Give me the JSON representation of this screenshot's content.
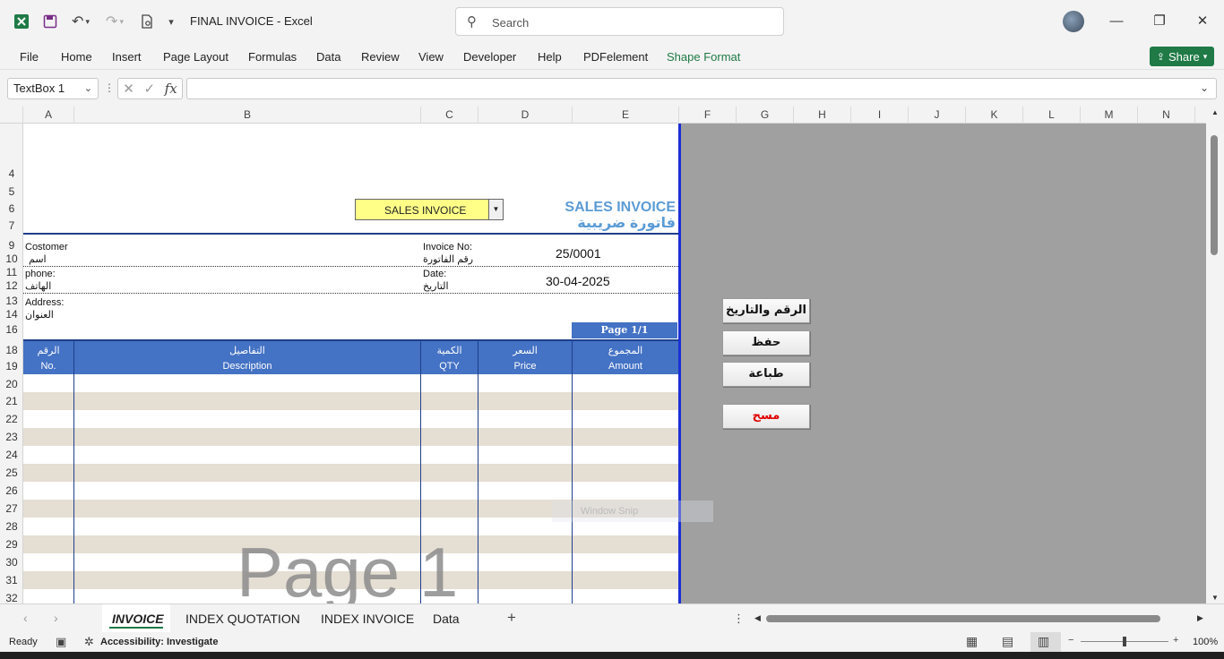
{
  "titlebar": {
    "doc_title": "FINAL INVOICE  -  Excel",
    "search_placeholder": "Search"
  },
  "menu": [
    "File",
    "Home",
    "Insert",
    "Page Layout",
    "Formulas",
    "Data",
    "Review",
    "View",
    "Developer",
    "Help",
    "PDFelement",
    "Shape Format"
  ],
  "share_label": "Share",
  "namebox": "TextBox 1",
  "fx_label": "fx",
  "columns": [
    "A",
    "B",
    "C",
    "D",
    "E",
    "F",
    "G",
    "H",
    "I",
    "J",
    "K",
    "L",
    "M",
    "N"
  ],
  "rows": [
    "4",
    "5",
    "6",
    "7",
    "9",
    "10",
    "11",
    "12",
    "13",
    "14",
    "16",
    "18",
    "19",
    "20",
    "21",
    "22",
    "23",
    "24",
    "25",
    "26",
    "27",
    "28",
    "29",
    "30",
    "31",
    "32"
  ],
  "invoice": {
    "type_dropdown": "SALES INVOICE",
    "title_en": "SALES INVOICE",
    "title_ar": "فاتورة ضريبية",
    "customer_en": "Costomer",
    "customer_ar": "اسم",
    "phone_en": "phone:",
    "phone_ar": "الهاتف",
    "address_en": "Address:",
    "address_ar": "العنوان",
    "invoice_no_en": "Invoice No:",
    "invoice_no_ar": "رقم الفاتورة",
    "invoice_no_value": "25/0001",
    "date_en": "Date:",
    "date_ar": "التاريخ",
    "date_value": "30-04-2025",
    "page_badge": "Page 1/1",
    "headers": [
      {
        "ar": "الرقم",
        "en": "No."
      },
      {
        "ar": "التفاصيل",
        "en": "Description"
      },
      {
        "ar": "الكمية",
        "en": "QTY"
      },
      {
        "ar": "السعر",
        "en": "Price"
      },
      {
        "ar": "المجموع",
        "en": "Amount"
      }
    ],
    "watermark": "Page 1"
  },
  "macro_buttons": {
    "number_date": "الرقم والتاريخ",
    "save": "حفظ",
    "print": "طباعة",
    "clear": "مسح"
  },
  "snip_label": "Window Snip",
  "sheets": [
    "INVOICE",
    "INDEX QUOTATION",
    "INDEX INVOICE",
    "Data"
  ],
  "status": {
    "ready": "Ready",
    "accessibility": "Accessibility: Investigate",
    "zoom": "100%"
  },
  "colors": {
    "excel_green": "#1f7a46",
    "header_blue": "#4472c4",
    "title_blue": "#5b9bd5",
    "dropdown_yellow": "#ffff88",
    "clear_red": "#e00000"
  }
}
